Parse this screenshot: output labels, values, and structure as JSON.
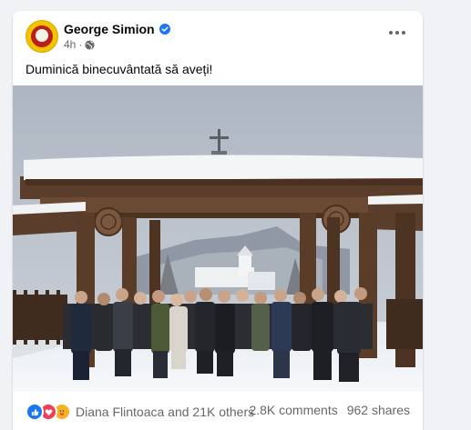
{
  "post": {
    "author": "George Simion",
    "time": "4h",
    "separator": "·",
    "caption": "Duminică binecuvântată să aveți!",
    "photo_icon": "group-photo-at-monastery-wooden-gate"
  },
  "footer": {
    "reactions_text": "Diana Flintoaca and 21K others",
    "comments": "2.8K comments",
    "shares": "962 shares",
    "reaction_icons": [
      "like-icon",
      "love-icon",
      "care-icon"
    ]
  },
  "colors": {
    "background": "#f0f2f5",
    "verified": "#1877f2",
    "like": "#1877f2",
    "love": "#f33e58",
    "care": "#f7b125",
    "secondary_text": "#65676b"
  }
}
